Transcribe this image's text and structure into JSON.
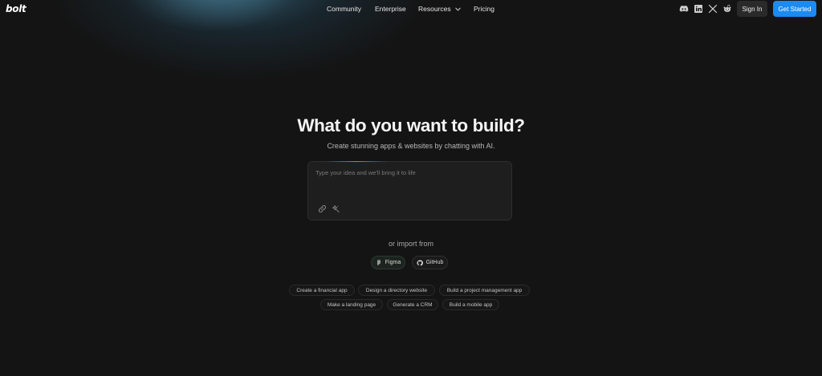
{
  "brand": {
    "logo_text": "bolt"
  },
  "nav": {
    "items": [
      {
        "label": "Community"
      },
      {
        "label": "Enterprise"
      },
      {
        "label": "Resources"
      },
      {
        "label": "Pricing"
      }
    ]
  },
  "social": [
    "discord-icon",
    "linkedin-icon",
    "x-icon",
    "reddit-icon"
  ],
  "auth": {
    "sign_in": "Sign In",
    "get_started": "Get Started"
  },
  "hero": {
    "title": "What do you want to build?",
    "subtitle": "Create stunning apps & websites by chatting with AI."
  },
  "prompt": {
    "placeholder": "Type your idea and we'll bring it to life",
    "value": ""
  },
  "import": {
    "label": "or import from",
    "figma": "Figma",
    "github": "GitHub"
  },
  "suggestions": [
    "Create a financial app",
    "Design a directory website",
    "Build a project management app",
    "Make a landing page",
    "Generate a CRM",
    "Build a mobile app"
  ],
  "colors": {
    "background": "#141414",
    "accent": "#1b8af2",
    "glow": "#4a8caf"
  }
}
